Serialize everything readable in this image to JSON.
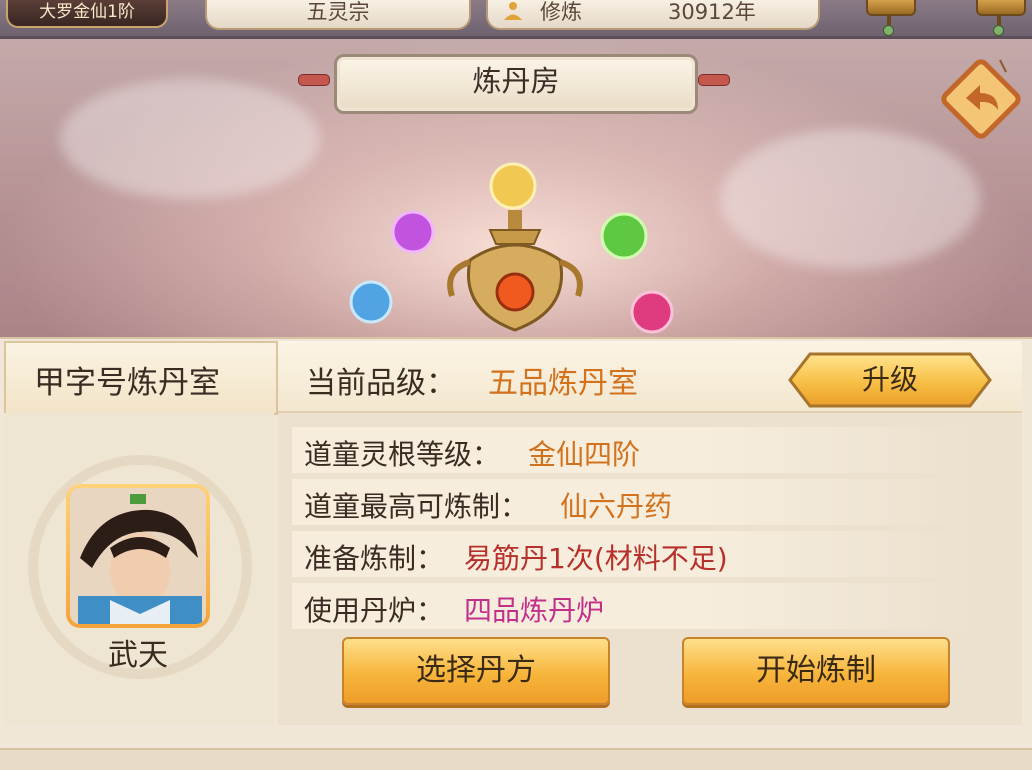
{
  "topbar": {
    "rank": "大罗金仙1阶",
    "sect": "五灵宗",
    "cultivation_label": "修炼",
    "cultivation_value": "30912年"
  },
  "scene": {
    "title": "炼丹房",
    "orb_colors": [
      "#f2c94c",
      "#c04de0",
      "#58c83c",
      "#4aa3e6",
      "#e0367e",
      "#f05a1e"
    ]
  },
  "room": {
    "name": "甲字号炼丹室",
    "grade_label": "当前品级：",
    "grade_value": "五品炼丹室",
    "upgrade_label": "升级"
  },
  "disciple": {
    "name": "武天",
    "spirit_root_label": "道童灵根等级：",
    "spirit_root_value": "金仙四阶",
    "max_refine_label": "道童最高可炼制：",
    "max_refine_value": "仙六丹药",
    "prepare_label": "准备炼制：",
    "prepare_value": "易筋丹1次(材料不足)",
    "furnace_label": "使用丹炉：",
    "furnace_value": "四品炼丹炉"
  },
  "actions": {
    "select_recipe": "选择丹方",
    "start_refine": "开始炼制"
  },
  "colors": {
    "accent_orange": "#d3721d",
    "warning_red": "#b7302a",
    "furnace_magenta": "#c2308a",
    "button_gold": "#f7b53c"
  }
}
